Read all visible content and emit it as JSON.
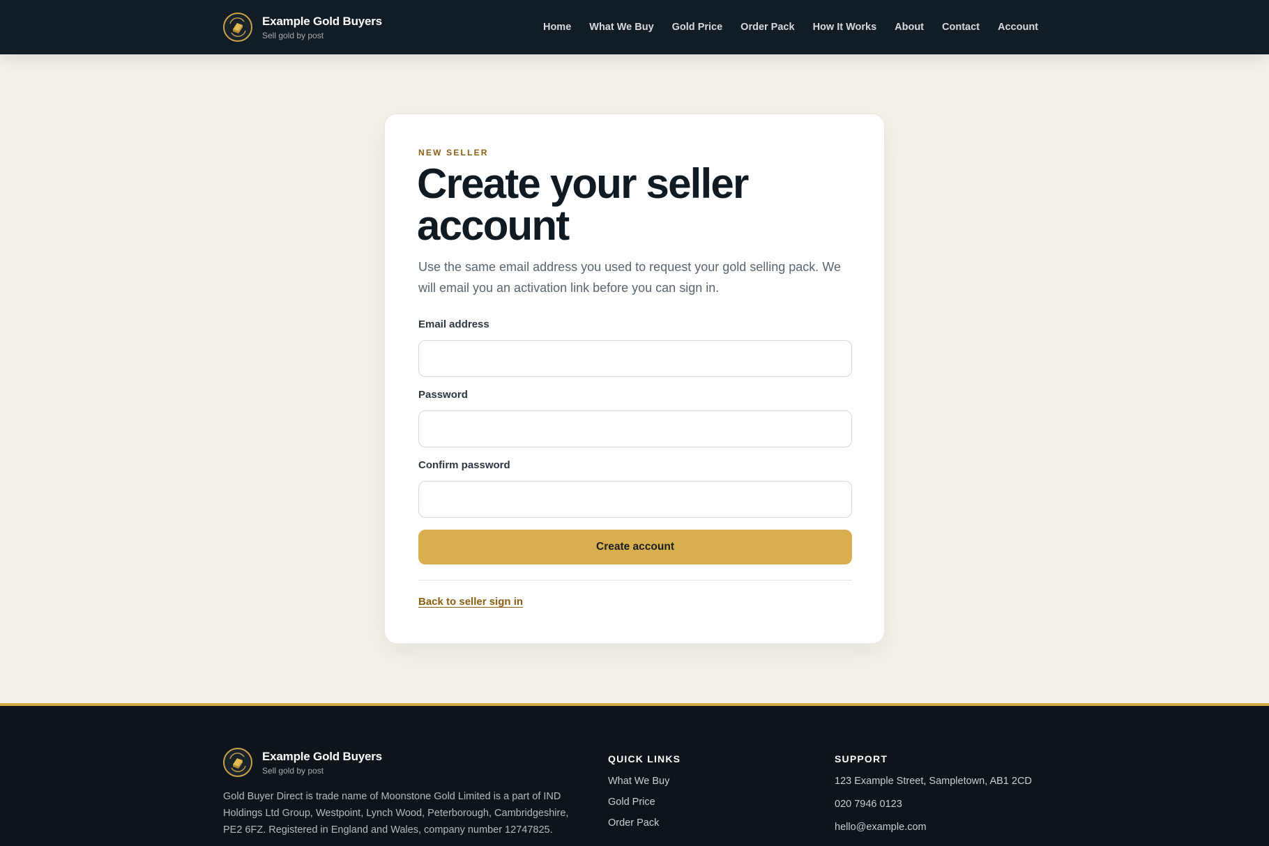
{
  "brand": {
    "name": "Example Gold Buyers",
    "tagline": "Sell gold by post"
  },
  "nav": {
    "items": [
      "Home",
      "What We Buy",
      "Gold Price",
      "Order Pack",
      "How It Works",
      "About",
      "Contact",
      "Account"
    ]
  },
  "form": {
    "eyebrow": "NEW SELLER",
    "title": "Create your seller account",
    "lead": "Use the same email address you used to request your gold selling pack. We will email you an activation link before you can sign in.",
    "email_label": "Email address",
    "email_value": "",
    "password_label": "Password",
    "password_value": "",
    "confirm_label": "Confirm password",
    "confirm_value": "",
    "submit_label": "Create account",
    "back_link": "Back to seller sign in"
  },
  "footer": {
    "brand_name": "Example Gold Buyers",
    "brand_tagline": "Sell gold by post",
    "about": "Gold Buyer Direct is trade name of Moonstone Gold Limited is a part of IND Holdings Ltd Group, Westpoint, Lynch Wood, Peterborough, Cambridgeshire, PE2 6FZ. Registered in England and Wales, company number 12747825.",
    "quick_links_title": "QUICK LINKS",
    "quick_links": [
      "What We Buy",
      "Gold Price",
      "Order Pack"
    ],
    "support_title": "SUPPORT",
    "support": {
      "address": "123 Example Street, Sampletown, AB1 2CD",
      "phone": "020 7946 0123",
      "email": "hello@example.com"
    }
  },
  "colors": {
    "header_bg": "#121c24",
    "page_bg": "#f4f1ea",
    "accent_gold": "#d8ae4e",
    "link_brown": "#8a5f12",
    "footer_bg": "#0d141a"
  },
  "icons": {
    "brand_logo": "gold-bar-logo-icon"
  }
}
